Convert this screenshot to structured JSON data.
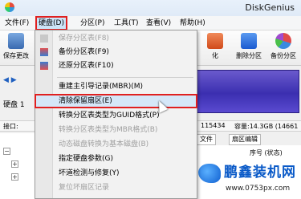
{
  "window": {
    "title": "DiskGenius"
  },
  "menubar": {
    "items": [
      "文件(F)",
      "硬盘(D)",
      "分区(P)",
      "工具(T)",
      "查看(V)",
      "帮助(H)"
    ],
    "active_index": 1
  },
  "toolbar": {
    "items": [
      {
        "label": "保存更改",
        "icon": "save-icon",
        "color": "#4a7ab8"
      },
      {
        "label": "化",
        "icon": "format-icon",
        "color": "#e05a2a"
      },
      {
        "label": "删除分区",
        "icon": "delete-partition-icon",
        "color": "#2a6ad0"
      },
      {
        "label": "备份分区",
        "icon": "backup-partition-icon",
        "color": "#8a3ac0"
      }
    ]
  },
  "diskbar": {
    "label": "硬盘 1",
    "nav": "◀ ▶"
  },
  "infobar": {
    "left": "接口:",
    "middle": "115434",
    "right": "容量:14.3GB (14661"
  },
  "tabs": [
    "文件",
    "扇区编辑"
  ],
  "right_pane": {
    "column": "序号 (状态)"
  },
  "dropdown": {
    "items": [
      {
        "label": "保存分区表(F8)",
        "disabled": true,
        "icon": "save-table-icon"
      },
      {
        "label": "备份分区表(F9)",
        "disabled": false,
        "icon": "backup-table-icon"
      },
      {
        "label": "还原分区表(F10)",
        "disabled": false,
        "icon": "restore-table-icon"
      },
      {
        "separator": true
      },
      {
        "label": "重建主引导记录(MBR)(M)",
        "disabled": false
      },
      {
        "label": "清除保留扇区(E)",
        "disabled": false,
        "highlighted": true
      },
      {
        "label": "转换分区表类型为GUID格式(P)",
        "disabled": false
      },
      {
        "label": "转换分区表类型为MBR格式(B)",
        "disabled": true
      },
      {
        "label": "动态磁盘转换为基本磁盘(B)",
        "disabled": true
      },
      {
        "label": "指定硬盘参数(G)",
        "disabled": false
      },
      {
        "label": "坏道检测与修复(Y)",
        "disabled": false
      },
      {
        "label": "复位坏扇区记录",
        "disabled": true
      }
    ]
  },
  "watermark": {
    "name": "鹏鑫装机网",
    "url": "www.0753px.com"
  },
  "colors": {
    "highlight": "#d5e7f8",
    "red_box": "#e02020",
    "disk_purple": "#3b2fb0"
  }
}
